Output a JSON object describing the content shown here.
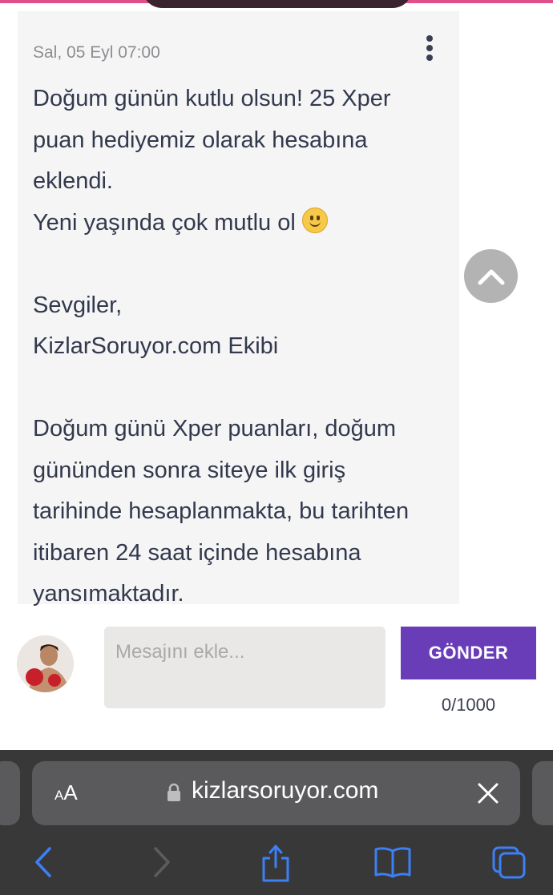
{
  "message": {
    "time": "Sal, 05 Eyl 07:00",
    "lines": [
      "Doğum günün kutlu olsun! 25 Xper",
      "puan hediyemiz olarak hesabına",
      "eklendi.",
      "Yeni yaşında çok mutlu ol",
      "",
      "Sevgiler,",
      "KizlarSoruyor.com Ekibi",
      "",
      "Doğum günü Xper puanları, doğum",
      "gününden sonra siteye ilk giriş",
      "tarihinde hesaplanmakta, bu tarihten",
      "itibaren 24 saat içinde hesabına",
      "yansımaktadır."
    ],
    "emoji": "slightly-smiling-face"
  },
  "compose": {
    "placeholder": "Mesajını ekle...",
    "send_label": "GÖNDER",
    "char_count": "0/1000"
  },
  "browser": {
    "aa_small": "A",
    "aa_big": "A",
    "url": "kizlarsoruyor.com"
  },
  "icons": [
    "kebab-menu-icon",
    "chevron-up-icon",
    "lock-icon",
    "close-icon",
    "back-icon",
    "forward-icon",
    "share-icon",
    "bookmarks-icon",
    "tabs-icon"
  ],
  "colors": {
    "accent": "#6a3db8",
    "top_bar": "#e0508a",
    "toolbar_icons": "#3d7ff5"
  }
}
